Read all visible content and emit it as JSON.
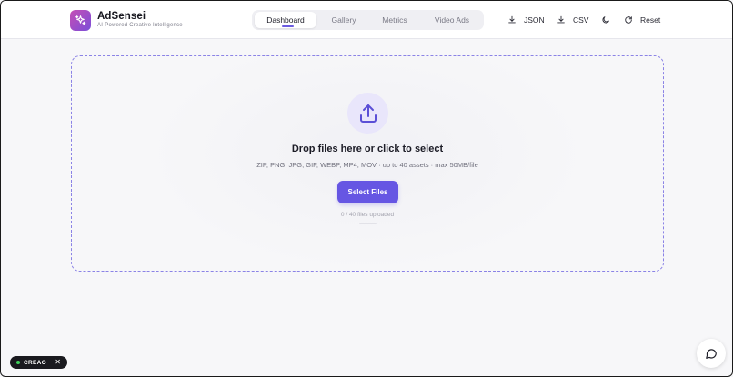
{
  "brand": {
    "title": "AdSensei",
    "subtitle": "AI-Powered Creative Intelligence",
    "logo_icon": "sparkles-icon",
    "gradient": [
      "#c54db5",
      "#7b4fd8"
    ]
  },
  "nav": {
    "tabs": [
      {
        "label": "Dashboard",
        "active": true
      },
      {
        "label": "Gallery",
        "active": false
      },
      {
        "label": "Metrics",
        "active": false
      },
      {
        "label": "Video Ads",
        "active": false
      }
    ]
  },
  "actions": {
    "json_label": "JSON",
    "csv_label": "CSV",
    "reset_label": "Reset",
    "icons": [
      "download-icon",
      "download-icon",
      "moon-icon",
      "refresh-icon"
    ]
  },
  "upload": {
    "title": "Drop files here or click to select",
    "subtitle": "ZIP, PNG, JPG, GIF, WEBP, MP4, MOV · up to 40 assets · max 50MB/file",
    "button_label": "Select Files",
    "progress_text": "0 / 40 files uploaded",
    "progress_fraction": 0,
    "icon": "upload-icon"
  },
  "badge": {
    "label": "CREAO",
    "close": "✕"
  },
  "colors": {
    "accent": "#6656e3",
    "dashed_border": "#8b83e6",
    "status_dot": "#3fd25a"
  }
}
